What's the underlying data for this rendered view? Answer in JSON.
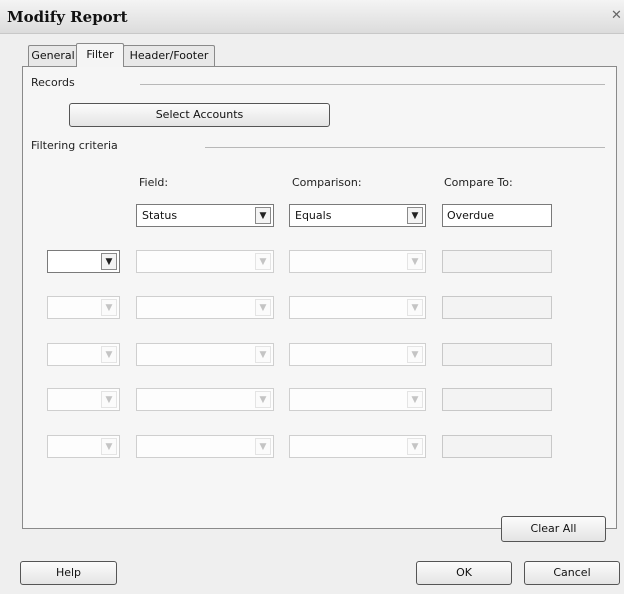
{
  "window": {
    "title": "Modify Report",
    "close_glyph": "✕"
  },
  "tabs": [
    {
      "label": "General",
      "active": false
    },
    {
      "label": "Filter",
      "active": true
    },
    {
      "label": "Header/Footer",
      "active": false
    }
  ],
  "records": {
    "label": "Records",
    "select_accounts_label": "Select Accounts"
  },
  "filtering": {
    "label": "Filtering criteria",
    "headers": {
      "field": "Field:",
      "comparison": "Comparison:",
      "compare_to": "Compare To:"
    },
    "first_row": {
      "field": "Status",
      "comparison": "Equals",
      "compare_to": "Overdue"
    },
    "logic_rows": [
      {
        "value": "",
        "enabled": true
      },
      {
        "value": "",
        "enabled": false
      },
      {
        "value": "",
        "enabled": false
      },
      {
        "value": "",
        "enabled": false
      },
      {
        "value": "",
        "enabled": false
      }
    ]
  },
  "buttons": {
    "clear_all": "Clear All",
    "help": "Help",
    "ok": "OK",
    "cancel": "Cancel"
  },
  "icons": {
    "dropdown_arrow": "chevron-down-icon",
    "close": "close-icon"
  }
}
